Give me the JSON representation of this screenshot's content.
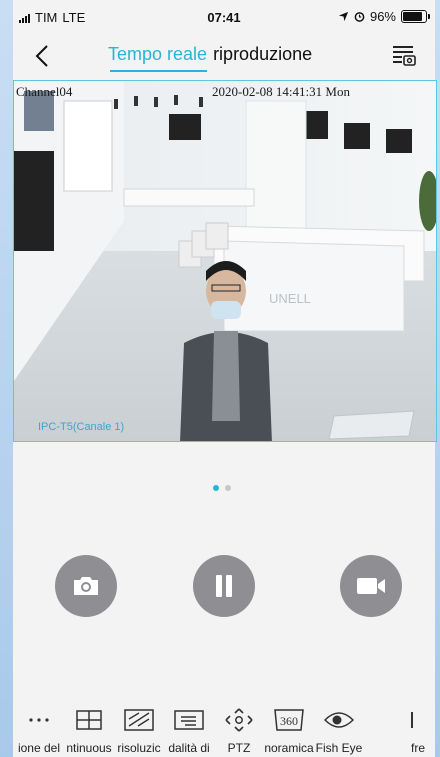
{
  "status_bar": {
    "carrier": "TIM",
    "network": "LTE",
    "time": "07:41",
    "battery": "96%",
    "battery_level": 0.96
  },
  "nav": {
    "tab_live": "Tempo reale",
    "tab_playback": "riproduzione"
  },
  "video": {
    "osd_channel": "Channel04",
    "osd_timestamp": "2020-02-08 14:41:31 Mon",
    "camera_label": "IPC-T5(Canale 1)"
  },
  "pager": {
    "pages": 2,
    "active": 0
  },
  "controls": {
    "snapshot": "camera-icon",
    "pause": "pause-icon",
    "record": "video-camera-icon"
  },
  "toolbar": {
    "items": [
      {
        "label": "ione del",
        "icon": "more-icon"
      },
      {
        "label": "ntinuous",
        "icon": "grid-icon"
      },
      {
        "label": "risoluzic",
        "icon": "resolution-icon"
      },
      {
        "label": "dalità di",
        "icon": "mode-icon"
      },
      {
        "label": "PTZ",
        "icon": "ptz-icon"
      },
      {
        "label": "noramica",
        "icon": "panorama-360-icon"
      },
      {
        "label": "Fish Eye",
        "icon": "fisheye-icon"
      },
      {
        "label": "fre",
        "icon": "partial-icon"
      }
    ]
  },
  "colors": {
    "accent": "#26b5d6",
    "control": "#8e8e93"
  }
}
